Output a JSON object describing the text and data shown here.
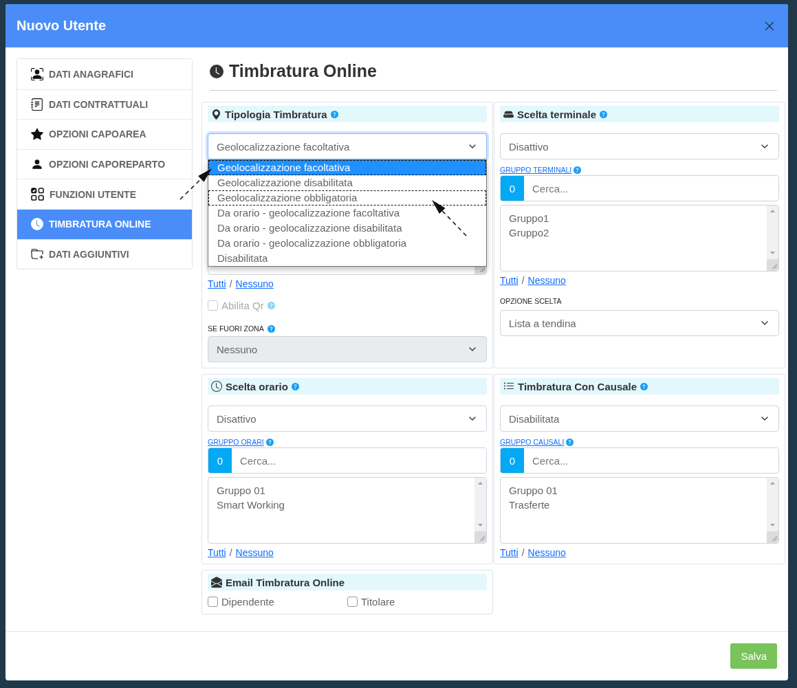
{
  "dialog": {
    "title": "Nuovo Utente"
  },
  "sidebar": {
    "items": [
      {
        "label": "DATI ANAGRAFICI",
        "selected": false
      },
      {
        "label": "DATI CONTRATTUALI",
        "selected": false
      },
      {
        "label": "OPZIONI CAPOAREA",
        "selected": false
      },
      {
        "label": "OPZIONI CAPOREPARTO",
        "selected": false
      },
      {
        "label": "FUNZIONI UTENTE",
        "selected": false
      },
      {
        "label": "TIMBRATURA ONLINE",
        "selected": true
      },
      {
        "label": "DATI AGGIUNTIVI",
        "selected": false
      }
    ]
  },
  "section_title": "Timbratura Online",
  "cards": [
    {
      "kind": "dropdown",
      "title": "Tipologia Timbratura",
      "select": {
        "value": "Geolocalizzazione facoltativa"
      },
      "options": [
        {
          "label": "Geolocalizzazione facoltativa",
          "selected": true,
          "outlined": true
        },
        {
          "label": "Geolocalizzazione disabilitata",
          "selected": false,
          "outlined": false
        },
        {
          "label": "Geolocalizzazione obbligatoria",
          "selected": false,
          "outlined": true
        },
        {
          "label": "Da orario - geolocalizzazione facoltativa",
          "selected": false,
          "outlined": false
        },
        {
          "label": "Da orario - geolocalizzazione disabilitata",
          "selected": false,
          "outlined": false
        },
        {
          "label": "Da orario - geolocalizzazione obbligatoria",
          "selected": false,
          "outlined": false
        },
        {
          "label": "Disabilitata",
          "selected": false,
          "outlined": false
        }
      ],
      "links": {
        "all": "Tutti",
        "separator": "/",
        "none": "Nessuno"
      },
      "checkbox": {
        "label": "Abilita Qr",
        "checked": false,
        "disabled": true
      },
      "extra": {
        "label": "SE FUORI ZONA",
        "value": "Nessuno",
        "disabled": true
      }
    },
    {
      "kind": "group",
      "title": "Scelta terminale",
      "select": {
        "value": "Disattivo"
      },
      "group": {
        "label": "GRUPPO TERMINALI",
        "count": "0",
        "placeholder": "Cerca...",
        "items": [
          "Gruppo1",
          "Gruppo2"
        ]
      },
      "links": {
        "all": "Tutti",
        "separator": "/",
        "none": "Nessuno"
      },
      "extra": {
        "label": "OPZIONE SCELTA",
        "value": "Lista a tendina",
        "disabled": false
      }
    },
    {
      "kind": "group",
      "title": "Scelta orario",
      "select": {
        "value": "Disattivo"
      },
      "group": {
        "label": "GRUPPO ORARI",
        "count": "0",
        "placeholder": "Cerca...",
        "items": [
          "Gruppo 01",
          "Smart Working"
        ]
      },
      "links": {
        "all": "Tutti",
        "separator": "/",
        "none": "Nessuno"
      }
    },
    {
      "kind": "group",
      "title": "Timbratura Con Causale",
      "select": {
        "value": "Disabilitata"
      },
      "group": {
        "label": "GRUPPO CAUSALI",
        "count": "0",
        "placeholder": "Cerca...",
        "items": [
          "Gruppo 01",
          "Trasferte"
        ]
      },
      "links": {
        "all": "Tutti",
        "separator": "/",
        "none": "Nessuno"
      }
    },
    {
      "kind": "checks",
      "title": "Email Timbratura Online",
      "checkboxes": [
        {
          "label": "Dipendente",
          "checked": false
        },
        {
          "label": "Titolare",
          "checked": false
        }
      ]
    }
  ],
  "footer": {
    "save": "Salva"
  }
}
